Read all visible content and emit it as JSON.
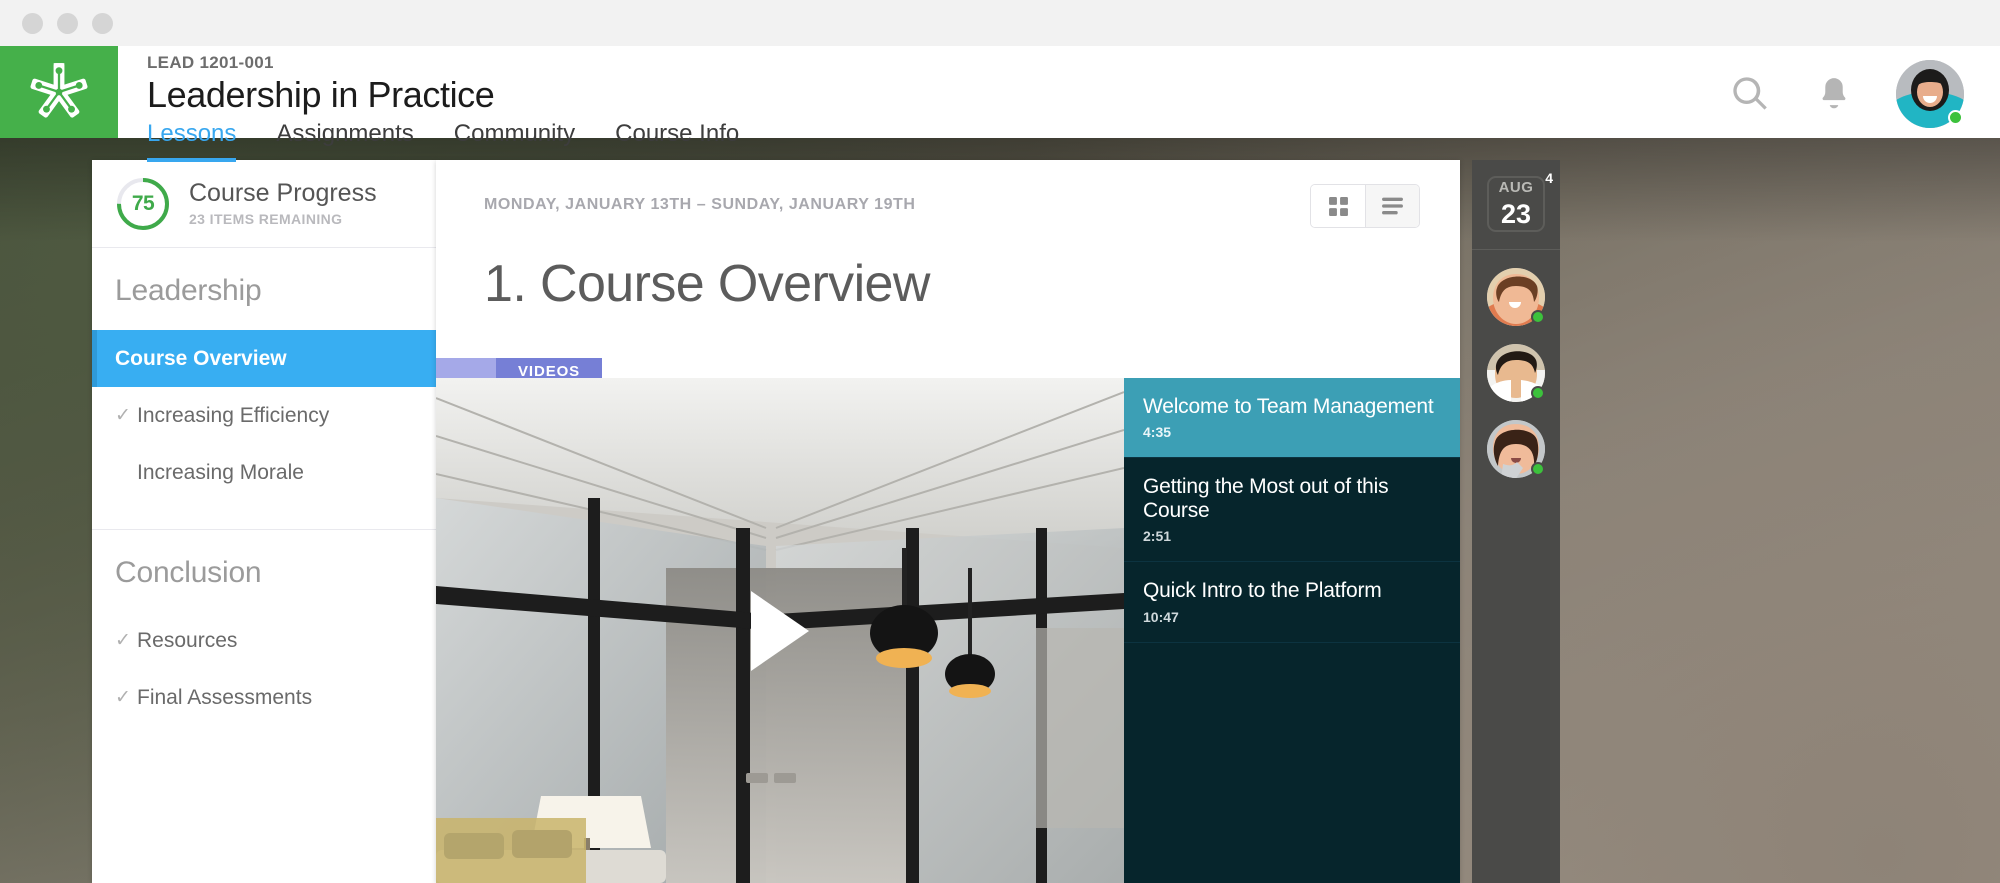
{
  "window": {
    "dots": [
      "close",
      "minimize",
      "maximize"
    ]
  },
  "header": {
    "logo_icon": "star-network-logo",
    "course_code": "LEAD 1201-001",
    "course_title": "Leadership in Practice",
    "tabs": [
      {
        "label": "Lessons",
        "active": true
      },
      {
        "label": "Assignments",
        "active": false
      },
      {
        "label": "Community",
        "active": false
      },
      {
        "label": "Course Info",
        "active": false
      }
    ],
    "actions": {
      "search_icon": "search-icon",
      "notifications_icon": "bell-icon",
      "avatar_status": "online"
    }
  },
  "sidebar": {
    "progress": {
      "value": "75",
      "percent": 75,
      "title": "Course Progress",
      "subtitle": "23 ITEMS REMAINING",
      "ring_color": "#3faa4a",
      "ring_track_color": "#e8e8ee"
    },
    "sections": [
      {
        "heading": "Leadership",
        "items": [
          {
            "label": "Course Overview",
            "active": true,
            "completed": false
          },
          {
            "label": "Increasing Efficiency",
            "active": false,
            "completed": true
          },
          {
            "label": "Increasing Morale",
            "active": false,
            "completed": false
          }
        ]
      },
      {
        "heading": "Conclusion",
        "items": [
          {
            "label": "Resources",
            "active": false,
            "completed": true
          },
          {
            "label": "Final Assessments",
            "active": false,
            "completed": true
          }
        ]
      }
    ]
  },
  "main": {
    "date_range": "MONDAY, JANUARY 13TH – SUNDAY, JANUARY 19TH",
    "view_toggle": [
      {
        "name": "grid-view",
        "icon": "grid-icon",
        "active": false
      },
      {
        "name": "list-view",
        "icon": "list-icon",
        "active": true
      }
    ],
    "lesson_title": "1. Course Overview",
    "tag": "VIDEOS",
    "tag_color": "#767fd6",
    "tag_strip_color": "#a5a9e8",
    "player": {
      "play_icon": "play-triangle-icon"
    },
    "playlist": [
      {
        "title": "Welcome to Team Management",
        "duration": "4:35",
        "active": true
      },
      {
        "title": "Getting the Most out of this Course",
        "duration": "2:51",
        "active": false
      },
      {
        "title": "Quick Intro to the Platform",
        "duration": "10:47",
        "active": false
      }
    ]
  },
  "rail": {
    "calendar": {
      "month": "AUG",
      "day": "23",
      "badge": "4"
    },
    "people": [
      {
        "name": "person-1",
        "status": "online"
      },
      {
        "name": "person-2",
        "status": "online"
      },
      {
        "name": "person-3",
        "status": "online"
      }
    ]
  }
}
